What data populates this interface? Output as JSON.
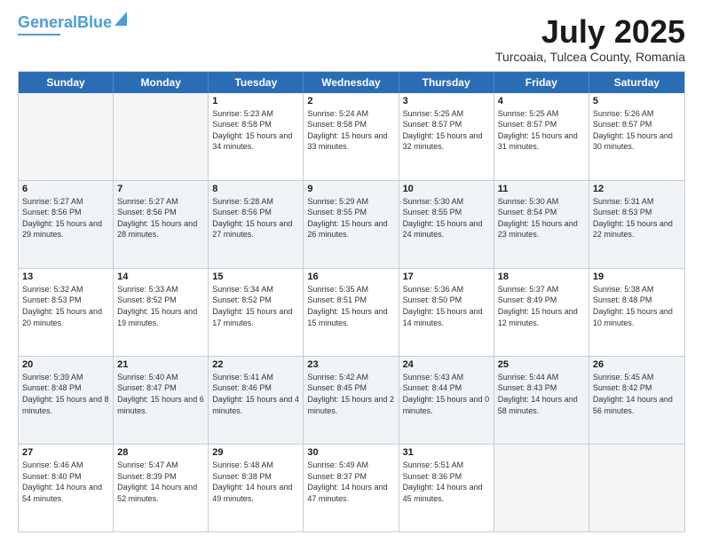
{
  "header": {
    "logo_general": "General",
    "logo_blue": "Blue",
    "month_title": "July 2025",
    "location": "Turcoaia, Tulcea County, Romania"
  },
  "days_of_week": [
    "Sunday",
    "Monday",
    "Tuesday",
    "Wednesday",
    "Thursday",
    "Friday",
    "Saturday"
  ],
  "weeks": [
    [
      {
        "day": "",
        "empty": true
      },
      {
        "day": "",
        "empty": true
      },
      {
        "day": "1",
        "sunrise": "5:23 AM",
        "sunset": "8:58 PM",
        "daylight": "15 hours and 34 minutes."
      },
      {
        "day": "2",
        "sunrise": "5:24 AM",
        "sunset": "8:58 PM",
        "daylight": "15 hours and 33 minutes."
      },
      {
        "day": "3",
        "sunrise": "5:25 AM",
        "sunset": "8:57 PM",
        "daylight": "15 hours and 32 minutes."
      },
      {
        "day": "4",
        "sunrise": "5:25 AM",
        "sunset": "8:57 PM",
        "daylight": "15 hours and 31 minutes."
      },
      {
        "day": "5",
        "sunrise": "5:26 AM",
        "sunset": "8:57 PM",
        "daylight": "15 hours and 30 minutes."
      }
    ],
    [
      {
        "day": "6",
        "sunrise": "5:27 AM",
        "sunset": "8:56 PM",
        "daylight": "15 hours and 29 minutes."
      },
      {
        "day": "7",
        "sunrise": "5:27 AM",
        "sunset": "8:56 PM",
        "daylight": "15 hours and 28 minutes."
      },
      {
        "day": "8",
        "sunrise": "5:28 AM",
        "sunset": "8:56 PM",
        "daylight": "15 hours and 27 minutes."
      },
      {
        "day": "9",
        "sunrise": "5:29 AM",
        "sunset": "8:55 PM",
        "daylight": "15 hours and 26 minutes."
      },
      {
        "day": "10",
        "sunrise": "5:30 AM",
        "sunset": "8:55 PM",
        "daylight": "15 hours and 24 minutes."
      },
      {
        "day": "11",
        "sunrise": "5:30 AM",
        "sunset": "8:54 PM",
        "daylight": "15 hours and 23 minutes."
      },
      {
        "day": "12",
        "sunrise": "5:31 AM",
        "sunset": "8:53 PM",
        "daylight": "15 hours and 22 minutes."
      }
    ],
    [
      {
        "day": "13",
        "sunrise": "5:32 AM",
        "sunset": "8:53 PM",
        "daylight": "15 hours and 20 minutes."
      },
      {
        "day": "14",
        "sunrise": "5:33 AM",
        "sunset": "8:52 PM",
        "daylight": "15 hours and 19 minutes."
      },
      {
        "day": "15",
        "sunrise": "5:34 AM",
        "sunset": "8:52 PM",
        "daylight": "15 hours and 17 minutes."
      },
      {
        "day": "16",
        "sunrise": "5:35 AM",
        "sunset": "8:51 PM",
        "daylight": "15 hours and 15 minutes."
      },
      {
        "day": "17",
        "sunrise": "5:36 AM",
        "sunset": "8:50 PM",
        "daylight": "15 hours and 14 minutes."
      },
      {
        "day": "18",
        "sunrise": "5:37 AM",
        "sunset": "8:49 PM",
        "daylight": "15 hours and 12 minutes."
      },
      {
        "day": "19",
        "sunrise": "5:38 AM",
        "sunset": "8:48 PM",
        "daylight": "15 hours and 10 minutes."
      }
    ],
    [
      {
        "day": "20",
        "sunrise": "5:39 AM",
        "sunset": "8:48 PM",
        "daylight": "15 hours and 8 minutes."
      },
      {
        "day": "21",
        "sunrise": "5:40 AM",
        "sunset": "8:47 PM",
        "daylight": "15 hours and 6 minutes."
      },
      {
        "day": "22",
        "sunrise": "5:41 AM",
        "sunset": "8:46 PM",
        "daylight": "15 hours and 4 minutes."
      },
      {
        "day": "23",
        "sunrise": "5:42 AM",
        "sunset": "8:45 PM",
        "daylight": "15 hours and 2 minutes."
      },
      {
        "day": "24",
        "sunrise": "5:43 AM",
        "sunset": "8:44 PM",
        "daylight": "15 hours and 0 minutes."
      },
      {
        "day": "25",
        "sunrise": "5:44 AM",
        "sunset": "8:43 PM",
        "daylight": "14 hours and 58 minutes."
      },
      {
        "day": "26",
        "sunrise": "5:45 AM",
        "sunset": "8:42 PM",
        "daylight": "14 hours and 56 minutes."
      }
    ],
    [
      {
        "day": "27",
        "sunrise": "5:46 AM",
        "sunset": "8:40 PM",
        "daylight": "14 hours and 54 minutes."
      },
      {
        "day": "28",
        "sunrise": "5:47 AM",
        "sunset": "8:39 PM",
        "daylight": "14 hours and 52 minutes."
      },
      {
        "day": "29",
        "sunrise": "5:48 AM",
        "sunset": "8:38 PM",
        "daylight": "14 hours and 49 minutes."
      },
      {
        "day": "30",
        "sunrise": "5:49 AM",
        "sunset": "8:37 PM",
        "daylight": "14 hours and 47 minutes."
      },
      {
        "day": "31",
        "sunrise": "5:51 AM",
        "sunset": "8:36 PM",
        "daylight": "14 hours and 45 minutes."
      },
      {
        "day": "",
        "empty": true
      },
      {
        "day": "",
        "empty": true
      }
    ]
  ]
}
